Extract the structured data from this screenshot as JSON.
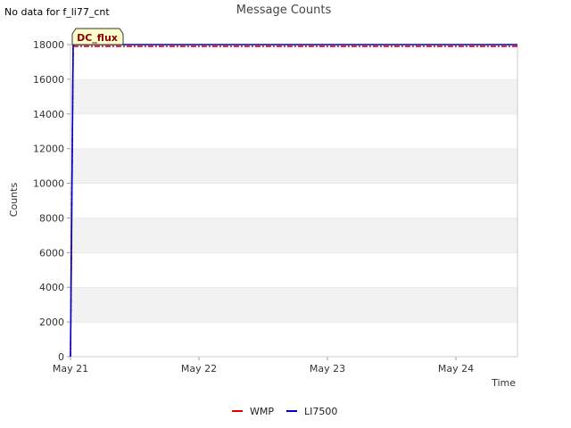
{
  "notice": "No data for f_li77_cnt",
  "chart_data": {
    "type": "line",
    "title": "Message Counts",
    "xlabel": "Time",
    "ylabel": "Counts",
    "ylim": [
      0,
      18000
    ],
    "xlim": [
      "2024-05-21",
      "2024-05-24 11:30"
    ],
    "yticks": [
      0,
      2000,
      4000,
      6000,
      8000,
      10000,
      12000,
      14000,
      16000,
      18000
    ],
    "xticks": [
      "May 21",
      "May 22",
      "May 23",
      "May 24"
    ],
    "grid": "alternating horizontal bands",
    "legend_position": "bottom-center",
    "badge": {
      "text": "DC_flux",
      "color": "#8b0000",
      "fill": "#ffffcc"
    },
    "series": [
      {
        "name": "WMP",
        "color": "#dd0000",
        "style": "dash-dot",
        "x": [
          "2024-05-21 00:00",
          "2024-05-21 00:30",
          "2024-05-24 11:30"
        ],
        "y": [
          0,
          17900,
          17900
        ]
      },
      {
        "name": "LI7500",
        "color": "#0000cc",
        "style": "solid",
        "x": [
          "2024-05-21 00:00",
          "2024-05-21 00:30",
          "2024-05-24 11:30"
        ],
        "y": [
          0,
          18000,
          18000
        ]
      }
    ]
  }
}
